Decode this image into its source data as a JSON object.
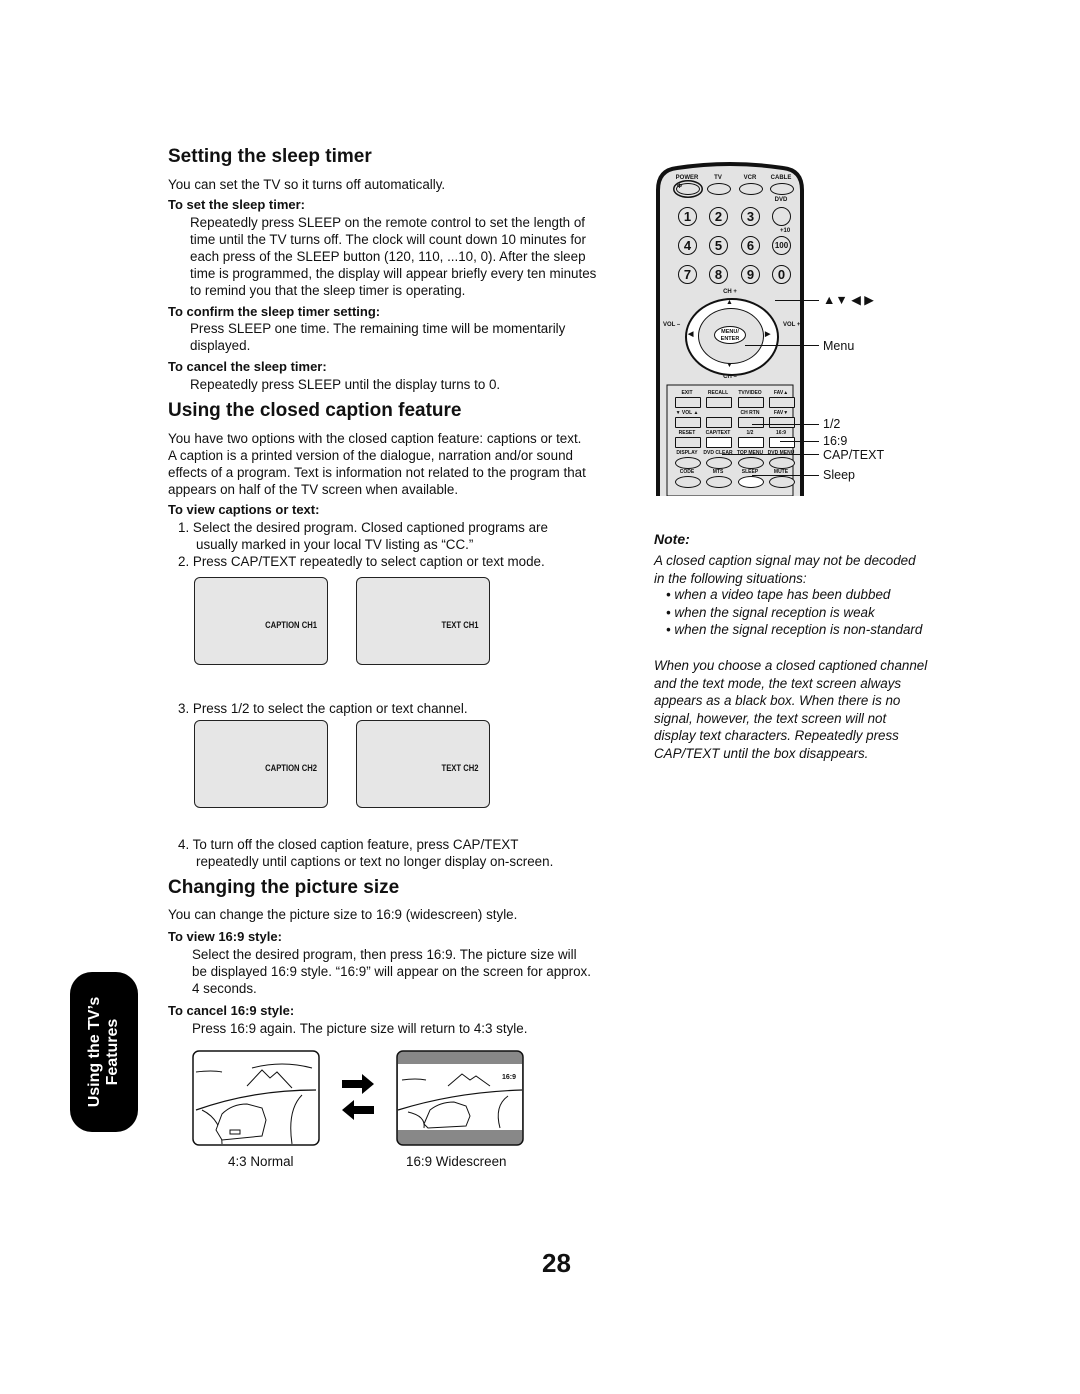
{
  "page_number": "28",
  "side_tab": {
    "line1": "Using the TV’s",
    "line2": "Features"
  },
  "sleep_timer": {
    "title": "Setting the sleep timer",
    "intro": "You can set the TV so it turns off automatically.",
    "set_heading": "To set the sleep timer:",
    "set_lines": [
      "Repeatedly press SLEEP on the remote control to set the length of",
      "time until the TV turns off. The clock will count down 10 minutes for",
      "each press of the SLEEP button (120, 110, ...10, 0). After the sleep",
      "time is programmed, the display will appear briefly every ten minutes",
      "to remind you that the sleep timer is operating."
    ],
    "confirm_heading": "To confirm the sleep timer setting:",
    "confirm_lines": [
      "Press SLEEP one time. The remaining time will be momentarily",
      "displayed."
    ],
    "cancel_heading": "To cancel the sleep timer:",
    "cancel_text": "Repeatedly press SLEEP until the display turns to 0."
  },
  "closed_caption": {
    "title": "Using the closed caption feature",
    "intro_lines": [
      "You have two options with the closed caption feature: captions or text.",
      "A caption is a printed version of the dialogue, narration and/or sound",
      "effects of a program. Text is information not related to the program that",
      "appears on half of the TV screen when available."
    ],
    "view_heading": "To view captions or text:",
    "step1_a": "1. Select the desired program. Closed captioned programs are",
    "step1_b": "usually marked in your local TV listing as “CC.”",
    "step2": "2. Press CAP/TEXT repeatedly to select caption or text mode.",
    "screens_row1": [
      "CAPTION CH1",
      "TEXT CH1"
    ],
    "step3": "3. Press 1/2 to select the caption or text channel.",
    "screens_row2": [
      "CAPTION CH2",
      "TEXT CH2"
    ],
    "step4_a": "4. To turn off the closed caption feature, press CAP/TEXT",
    "step4_b": "repeatedly until captions or text no longer display on-screen."
  },
  "picture_size": {
    "title": "Changing the picture size",
    "intro": "You can change the picture size to 16:9 (widescreen) style.",
    "view_heading": "To view 16:9 style:",
    "view_lines": [
      "Select the desired program, then press 16:9. The picture size will",
      "be displayed 16:9 style. “16:9” will appear on the screen for approx.",
      "4 seconds."
    ],
    "cancel_heading": "To cancel 16:9 style:",
    "cancel_text": "Press 16:9 again. The picture size will return to 4:3 style.",
    "normal_caption": "4:3 Normal",
    "wide_caption": "16:9 Widescreen",
    "wide_overlay": "16:9"
  },
  "note": {
    "heading": "Note:",
    "lines": [
      "A closed caption signal may not be decoded",
      "in the following situations:"
    ],
    "bullets": [
      "when a video tape has been dubbed",
      "when the signal reception is weak",
      "when the signal reception is non-standard"
    ],
    "para": [
      "When you choose a closed captioned channel",
      "and the text mode, the text screen always",
      "appears as a black box. When there is no",
      "signal, however, the text screen will not",
      "display text characters. Repeatedly press",
      "CAP/TEXT until the box disappears."
    ]
  },
  "remote": {
    "top_labels": [
      "POWER",
      "TV",
      "VCR",
      "CABLE"
    ],
    "dvd": "DVD",
    "plus10": "+10",
    "digits": [
      "1",
      "2",
      "3",
      "",
      "4",
      "5",
      "6",
      "100",
      "7",
      "8",
      "9",
      "0"
    ],
    "ch_plus": "CH +",
    "ch_minus": "CH –",
    "vol_minus": "VOL –",
    "vol_plus": "VOL +",
    "menu_enter": [
      "MENU/",
      "ENTER"
    ],
    "row_labels": [
      [
        "EXIT",
        "RECALL",
        "TV/VIDEO",
        "FAV▲"
      ],
      [
        "▼   VOL   ▲",
        "",
        "CH RTN",
        "FAV▼"
      ],
      [
        "RESET",
        "CAP/TEXT",
        "1/2",
        "16:9"
      ],
      [
        "DISPLAY",
        "DVD CLEAR",
        "TOP MENU",
        "DVD MENU"
      ],
      [
        "CODE",
        "MTS",
        "SLEEP",
        "MUTE"
      ]
    ],
    "callouts": {
      "arrows": "▲▼ ◀ ▶",
      "menu": "Menu",
      "half": "1/2",
      "wide": "16:9",
      "captext": "CAP/TEXT",
      "sleep": "Sleep"
    }
  }
}
